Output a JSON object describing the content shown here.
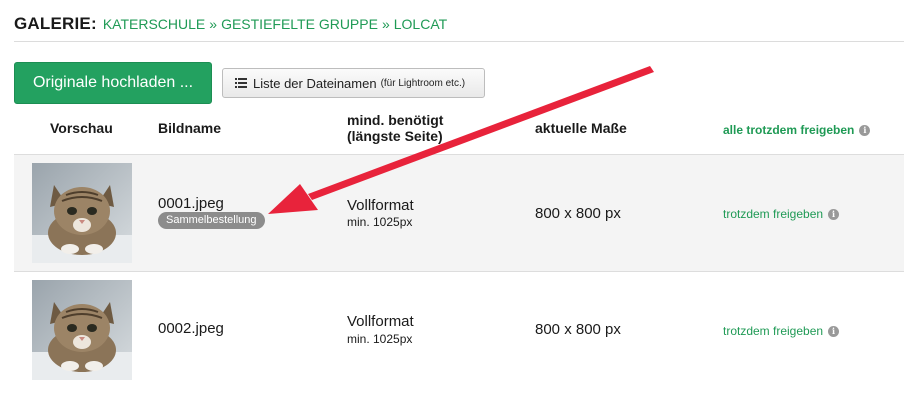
{
  "header": {
    "label": "GALERIE:",
    "crumbs": [
      "KATERSCHULE",
      "GESTIEFELTE GRUPPE",
      "LOLCAT"
    ],
    "separator": "»"
  },
  "toolbar": {
    "upload_label": "Originale hochladen ...",
    "list_label": "Liste der Dateinamen",
    "list_hint": "(für Lightroom etc.)"
  },
  "table": {
    "headers": {
      "preview": "Vorschau",
      "name": "Bildname",
      "min_required_line1": "mind. benötigt",
      "min_required_line2": "(längste Seite)",
      "current": "aktuelle Maße",
      "release_all": "alle trotzdem freigeben"
    },
    "rows": [
      {
        "name": "0001.jpeg",
        "badge": "Sammelbestellung",
        "format": "Vollformat",
        "min": "min. 1025px",
        "dims": "800 x 800 px",
        "release": "trotzdem freigeben"
      },
      {
        "name": "0002.jpeg",
        "badge": "",
        "format": "Vollformat",
        "min": "min. 1025px",
        "dims": "800 x 800 px",
        "release": "trotzdem freigeben"
      }
    ]
  },
  "icons": {
    "info": "info-icon",
    "list": "list-icon",
    "arrow": "annotation-arrow"
  },
  "colors": {
    "accent": "#23a160",
    "link": "#1f9a55",
    "arrow": "#e8233b"
  }
}
